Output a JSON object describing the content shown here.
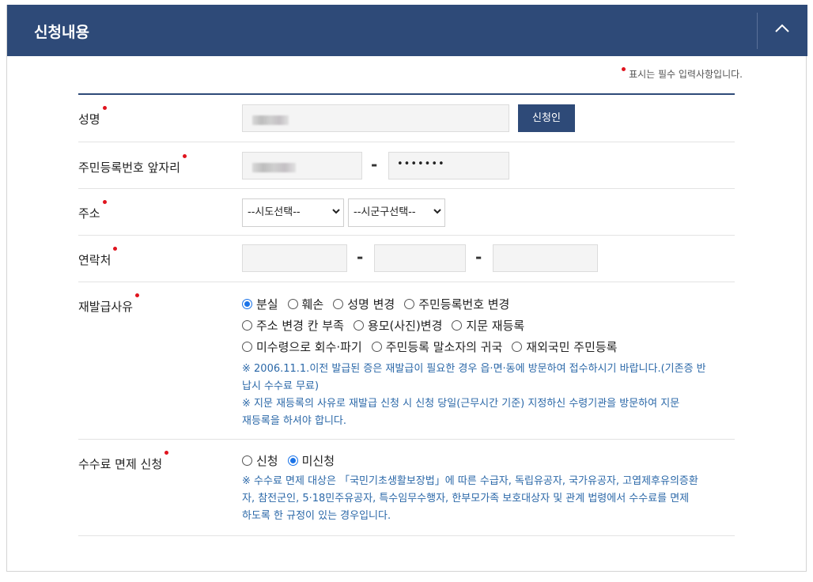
{
  "header": {
    "title": "신청내용",
    "collapse_icon": "chevron-up-icon"
  },
  "required_note": "표시는 필수 입력사항입니다.",
  "colors": {
    "header_bg": "#2e4a78",
    "required_dot": "#e0141e",
    "note_text": "#2b68a8",
    "radio_checked": "#1a73e8"
  },
  "name_row": {
    "label": "성명",
    "button": "신청인"
  },
  "rrn_row": {
    "label": "주민등록번호 앞자리",
    "back_value": "•••••••"
  },
  "address_row": {
    "label": "주소",
    "sido": "--시도선택--",
    "sigungu": "--시군구선택--"
  },
  "contact_row": {
    "label": "연락처"
  },
  "reason_row": {
    "label": "재발급사유",
    "options": [
      "분실",
      "훼손",
      "성명 변경",
      "주민등록번호 변경",
      "주소 변경 칸 부족",
      "용모(사진)변경",
      "지문 재등록",
      "미수령으로 회수·파기",
      "주민등록 말소자의 귀국",
      "재외국민 주민등록"
    ],
    "selected": "분실",
    "notes": [
      "※ 2006.11.1.이전 발급된 증은 재발급이 필요한 경우 읍·면·동에 방문하여 접수하시기 바랍니다.(기존증 반",
      "납시 수수료 무료)",
      "※ 지문 재등록의 사유로 재발급 신청 시 신청 당일(근무시간 기준) 지정하신 수령기관을 방문하여 지문",
      "재등록을 하셔야 합니다."
    ]
  },
  "fee_row": {
    "label": "수수료 면제 신청",
    "options": [
      "신청",
      "미신청"
    ],
    "selected": "미신청",
    "notes": [
      "※ 수수료 면제 대상은 「국민기초생활보장법」에 따른 수급자, 독립유공자, 국가유공자, 고엽제후유의증환",
      "자, 참전군인, 5·18민주유공자, 특수임무수행자, 한부모가족 보호대상자 및 관계 법령에서 수수료를 면제",
      "하도록 한 규정이 있는 경우입니다."
    ]
  }
}
